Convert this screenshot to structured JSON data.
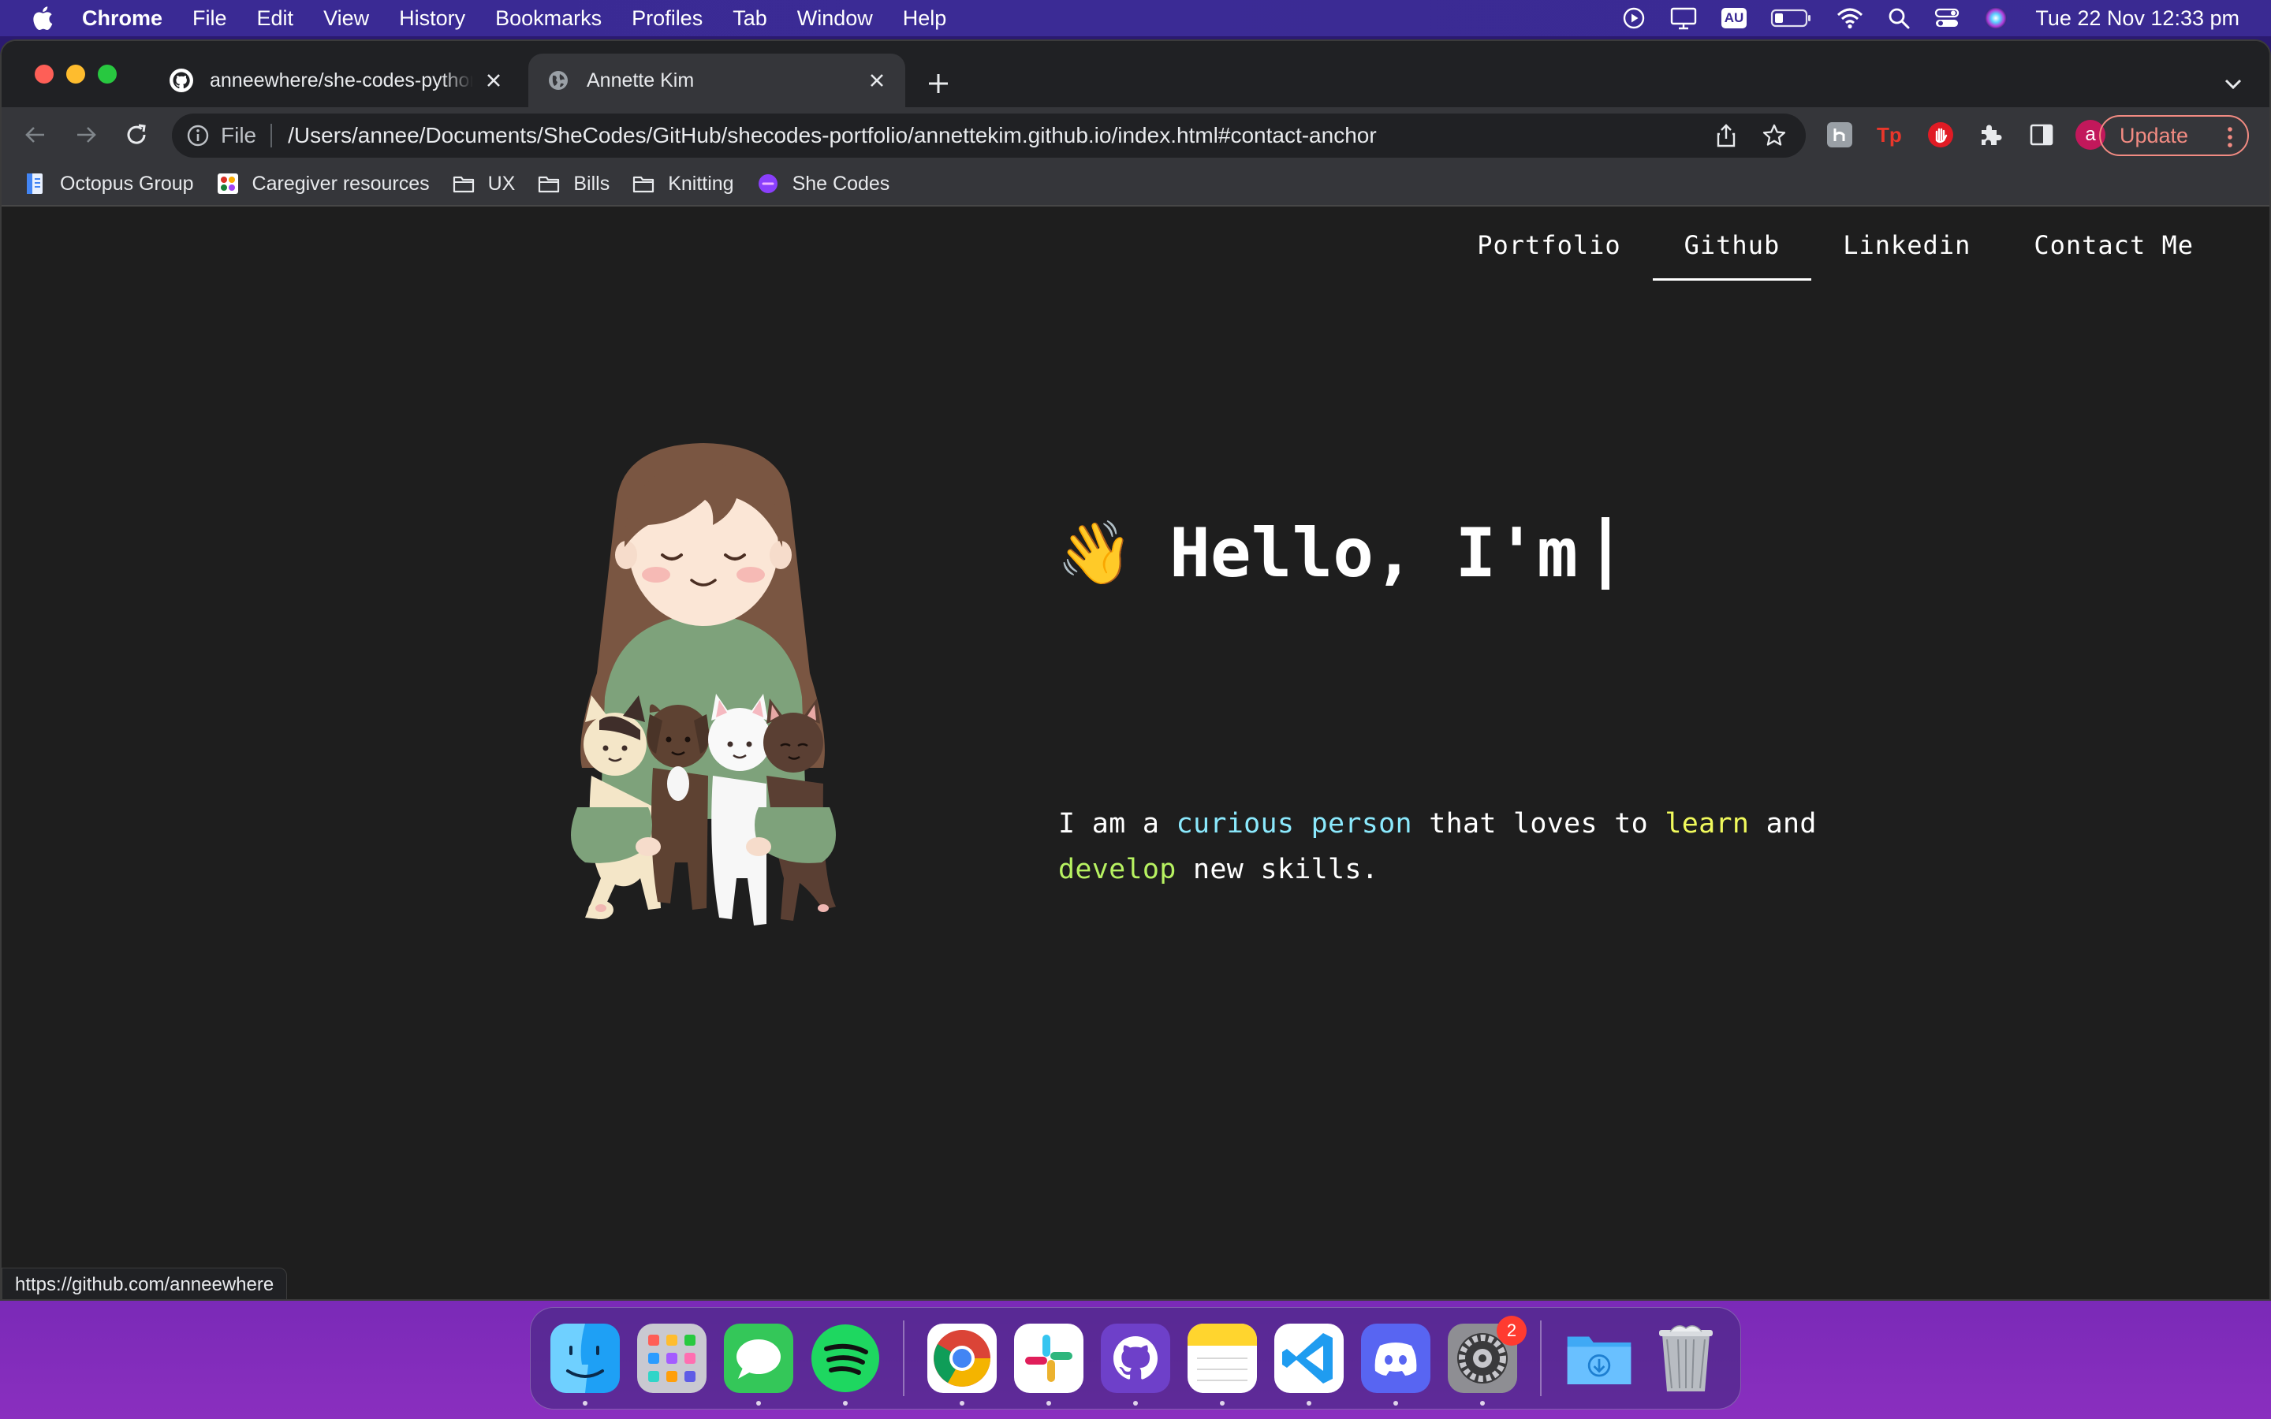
{
  "menubar": {
    "app_name": "Chrome",
    "items": [
      "File",
      "Edit",
      "View",
      "History",
      "Bookmarks",
      "Profiles",
      "Tab",
      "Window",
      "Help"
    ],
    "input_source": "AU",
    "datetime": "Tue 22 Nov  12:33 pm"
  },
  "browser": {
    "tabs": [
      {
        "title": "anneewhere/she-codes-python",
        "favicon": "github-icon"
      },
      {
        "title": "Annette Kim",
        "favicon": "globe-icon"
      }
    ],
    "omnibox": {
      "scheme_label": "File",
      "url": "/Users/annee/Documents/SheCodes/GitHub/shecodes-portfolio/annettekim.github.io/index.html#contact-anchor"
    },
    "profile_initial": "a",
    "update_label": "Update",
    "bookmarks": [
      {
        "label": "Octopus Group",
        "icon": "page-icon"
      },
      {
        "label": "Caregiver resources",
        "icon": "site-icon"
      },
      {
        "label": "UX",
        "icon": "folder-icon"
      },
      {
        "label": "Bills",
        "icon": "folder-icon"
      },
      {
        "label": "Knitting",
        "icon": "folder-icon"
      },
      {
        "label": "She Codes",
        "icon": "shecodes-icon"
      }
    ],
    "status_url": "https://github.com/anneewhere"
  },
  "page": {
    "nav": [
      "Portfolio",
      "Github",
      "Linkedin",
      "Contact Me"
    ],
    "active_nav": "Github",
    "hero": {
      "wave": "👋",
      "greeting": "Hello, I'm"
    },
    "about": {
      "p1": "I am a ",
      "h1": "curious person",
      "p2": " that loves to ",
      "h2": "learn",
      "p3": " and ",
      "h3": "develop",
      "p4": " new skills."
    },
    "colors": {
      "cyan": "#8be9fd",
      "yellow": "#f1fa5c",
      "green": "#b7f261"
    }
  },
  "dock": {
    "apps": [
      "Finder",
      "Launchpad",
      "Messages",
      "Spotify",
      "Chrome",
      "Slack",
      "GitHub Desktop",
      "Notes",
      "Visual Studio Code",
      "Discord",
      "System Preferences",
      "Downloads",
      "Trash"
    ],
    "system_preferences_badge": "2"
  }
}
